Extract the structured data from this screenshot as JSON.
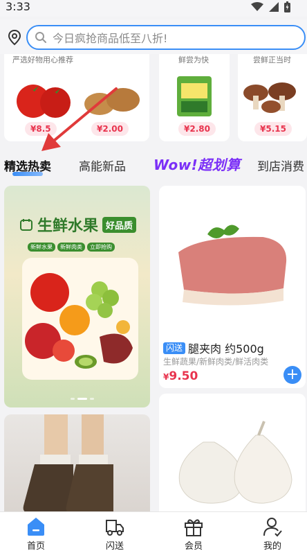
{
  "status": {
    "time": "3:33"
  },
  "search": {
    "placeholder": "今日疯抢商品低至八折!"
  },
  "top_cards": [
    {
      "subtitle": "严选好物用心推荐",
      "prices": [
        "¥8.5",
        "¥2.00"
      ]
    },
    {
      "subtitle": "鲜尝为快",
      "price": "¥2.80"
    },
    {
      "subtitle": "尝鲜正当时",
      "price": "¥5.15"
    }
  ],
  "tabs": {
    "items": [
      "精选热卖",
      "高能新品",
      "Wow!超划算",
      "到店消费"
    ],
    "active": 0
  },
  "feed": {
    "poster": {
      "title": "生鲜水果",
      "badge": "好品质",
      "tags": [
        "新鲜水果",
        "新鲜肉类",
        "立即抢购"
      ]
    },
    "product": {
      "flash_label": "闪送",
      "name": "腿夹肉 约500g",
      "category": "生鲜蔬果/新鲜肉类/鲜活肉类",
      "currency": "¥",
      "price": "9.50"
    }
  },
  "bottom_nav": {
    "items": [
      "首页",
      "闪送",
      "会员",
      "我的"
    ],
    "active": 0
  },
  "colors": {
    "accent": "#3a8ef6",
    "price": "#e8344e",
    "wow": "#7b2ff7"
  }
}
